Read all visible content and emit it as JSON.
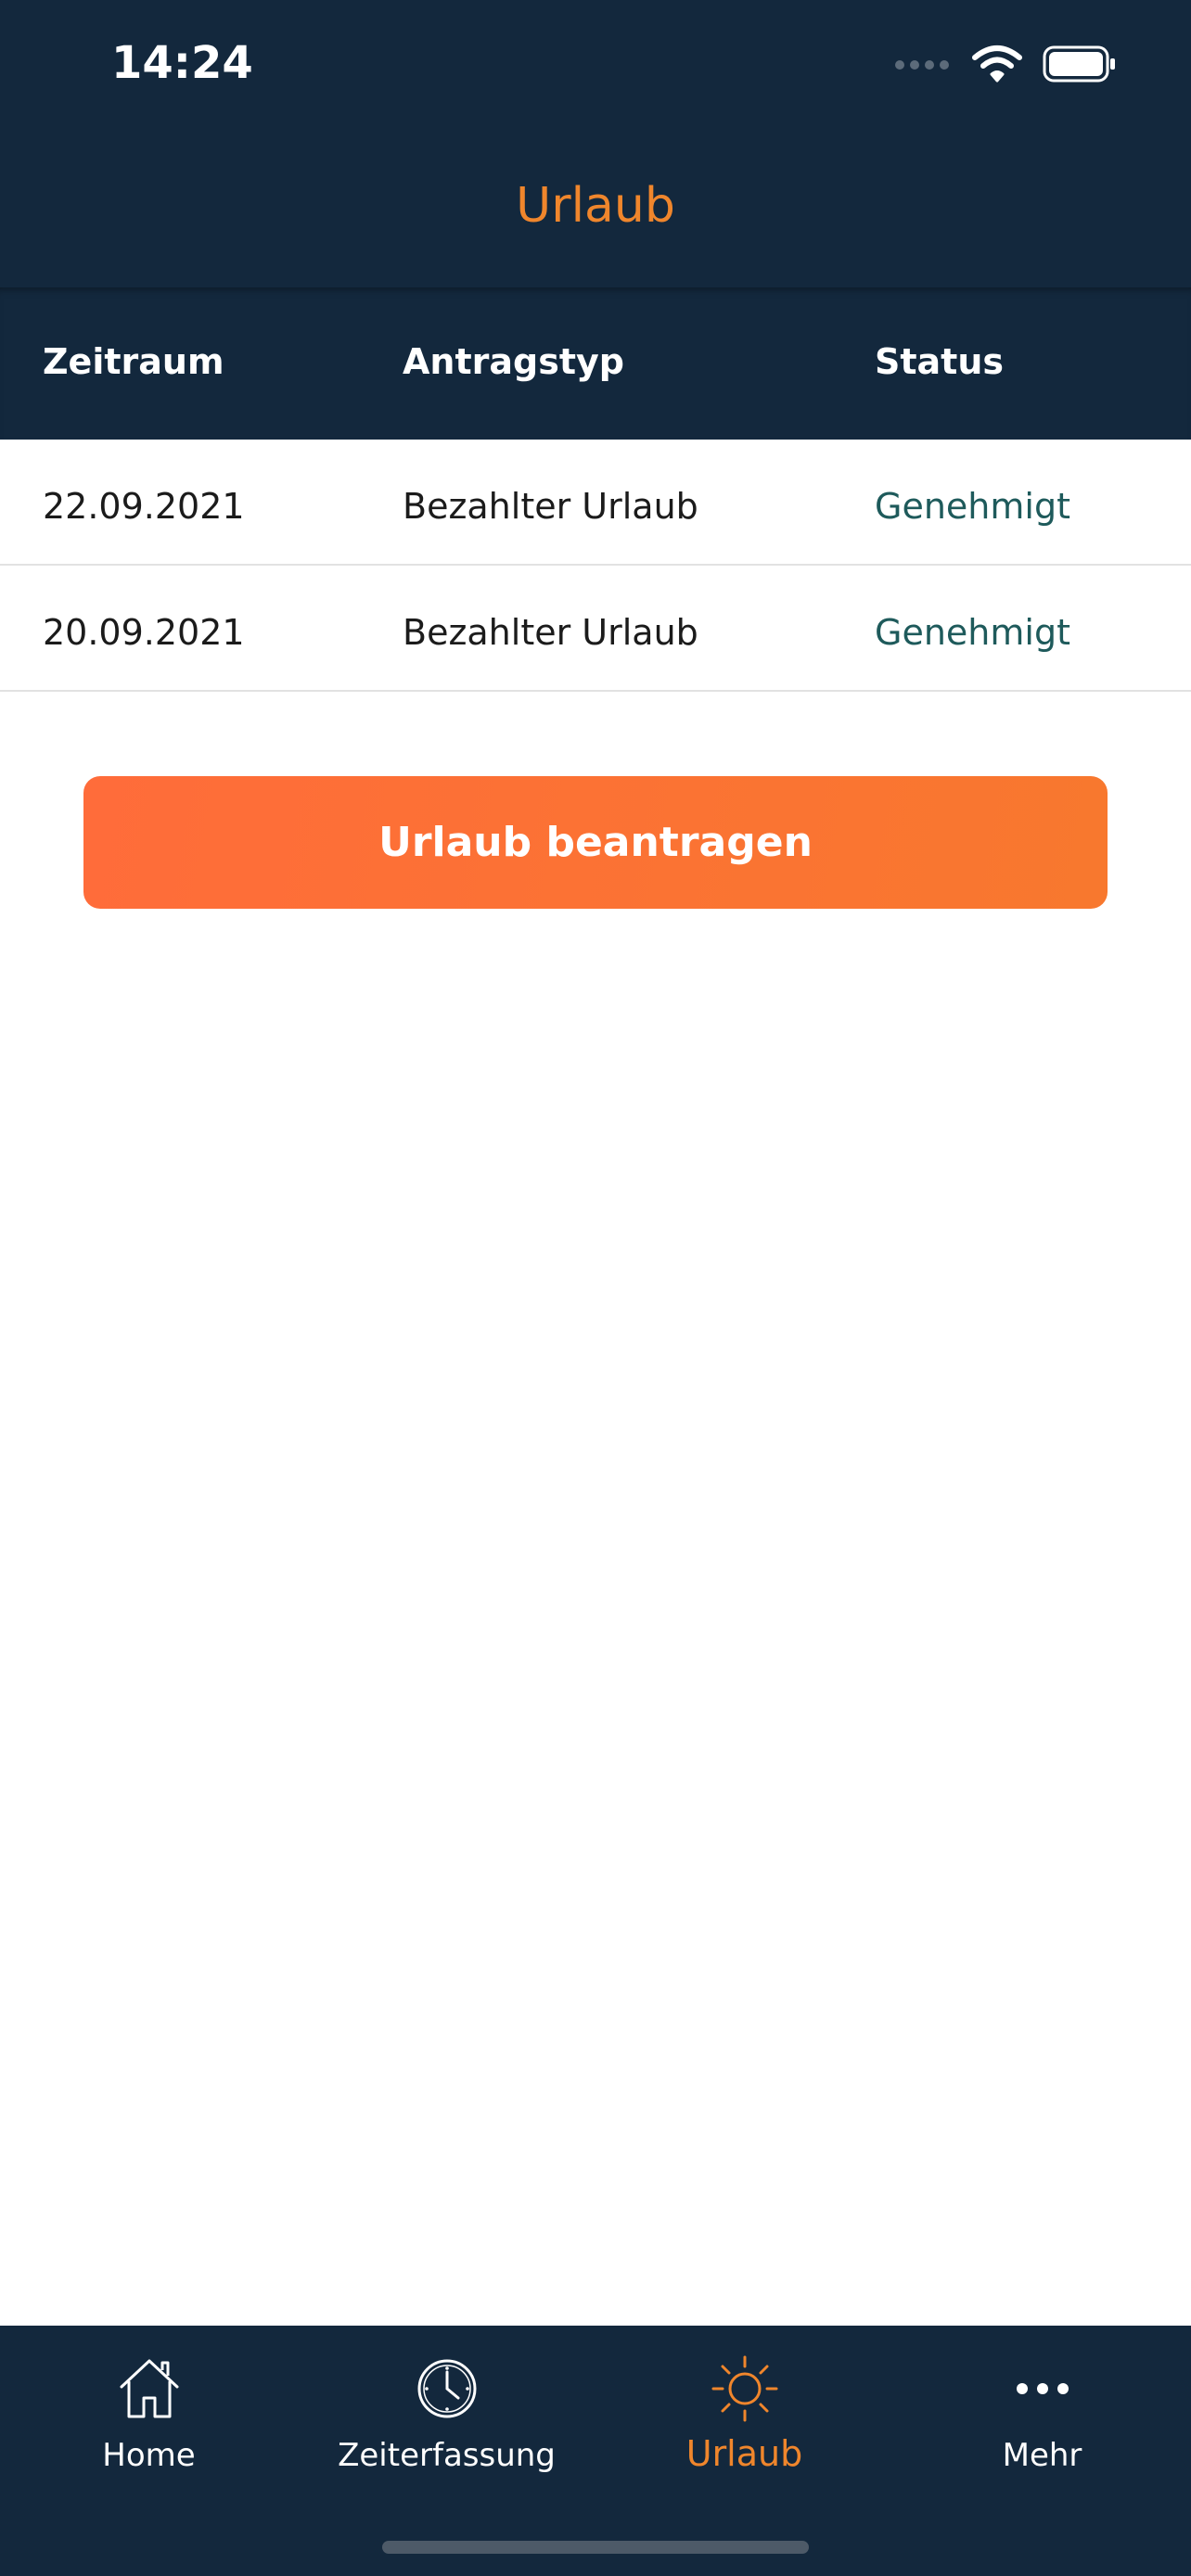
{
  "status_bar": {
    "time": "14:24"
  },
  "header": {
    "title": "Urlaub"
  },
  "table": {
    "columns": [
      "Zeitraum",
      "Antragstyp",
      "Status"
    ],
    "rows": [
      [
        "22.09.2021",
        "Bezahlter Urlaub",
        "Genehmigt"
      ],
      [
        "20.09.2021",
        "Bezahlter Urlaub",
        "Genehmigt"
      ]
    ]
  },
  "actions": {
    "request_label": "Urlaub beantragen"
  },
  "tabbar": {
    "items": [
      {
        "label": "Home",
        "icon": "house-icon"
      },
      {
        "label": "Zeiterfassung",
        "icon": "clock-icon"
      },
      {
        "label": "Urlaub",
        "icon": "sun-icon"
      },
      {
        "label": "Mehr",
        "icon": "more-dots-icon"
      }
    ],
    "active_index": 2
  },
  "colors": {
    "navy": "#13283d",
    "accent_orange": "#f0862c",
    "button_orange": "#ff6c3a",
    "status_green": "#1e5a5b"
  }
}
